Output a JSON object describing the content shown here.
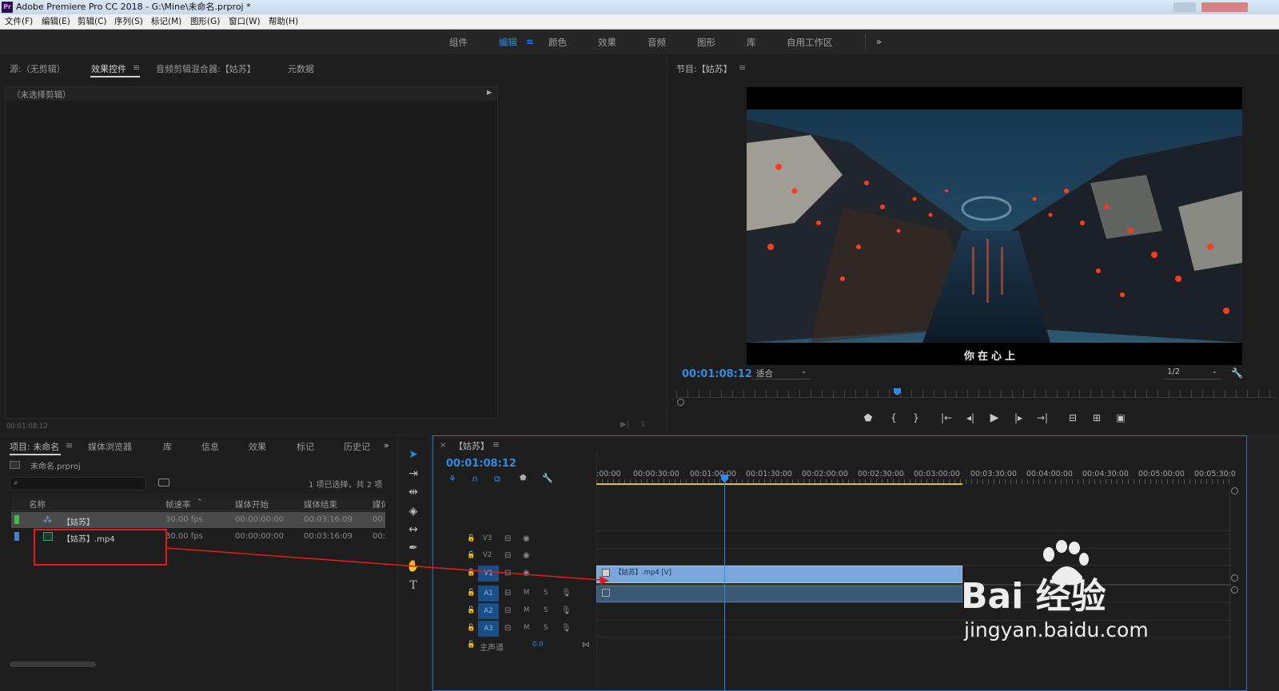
{
  "window": {
    "title": "Adobe Premiere Pro CC 2018 - G:\\Mine\\未命名.prproj *",
    "app_badge": "Pr"
  },
  "menu": [
    "文件(F)",
    "编辑(E)",
    "剪辑(C)",
    "序列(S)",
    "标记(M)",
    "图形(G)",
    "窗口(W)",
    "帮助(H)"
  ],
  "workspaces": {
    "items": [
      "组件",
      "编辑",
      "颜色",
      "效果",
      "音频",
      "图形",
      "库",
      "自用工作区"
    ],
    "active": "编辑",
    "more": "»"
  },
  "source_panel": {
    "tabs": [
      "源:（无剪辑）",
      "效果控件",
      "音频剪辑混合器:【姑苏】",
      "元数据"
    ],
    "active_tab": "效果控件",
    "no_clip": "（未选择剪辑）",
    "timecode": "00:01:08:12"
  },
  "program_panel": {
    "title": "节目:【姑苏】",
    "subtitle": "你在心上",
    "timecode": "00:01:08:12",
    "fit": "适合",
    "resolution": "1/2"
  },
  "project_panel": {
    "tabs": [
      "项目: 未命名",
      "媒体浏览器",
      "库",
      "信息",
      "效果",
      "标记",
      "历史记"
    ],
    "file": "未命名.prproj",
    "selection_info": "1 项已选择，共 2 项",
    "columns": [
      "名称",
      "帧速率",
      "媒体开始",
      "媒体结束",
      "媒体"
    ],
    "rows": [
      {
        "name": "【姑苏】",
        "fps": "30.00 fps",
        "start": "00:00:00:00",
        "end": "00:03:16:09",
        "extra": "00:",
        "color": "#3fbf4c",
        "selected": true
      },
      {
        "name": "【姑苏】.mp4",
        "fps": "30.00 fps",
        "start": "00:00:00:00",
        "end": "00:03:16:09",
        "extra": "00:",
        "color": "#4a7fd0",
        "selected": false
      }
    ]
  },
  "timeline": {
    "title": "【姑苏】",
    "timecode": "00:01:08:12",
    "ruler": [
      ":00:00",
      "00:00:30:00",
      "00:01:00:00",
      "00:01:30:00",
      "00:02:00:00",
      "00:02:30:00",
      "00:03:00:00",
      "00:03:30:00",
      "00:04:00:00",
      "00:04:30:00",
      "00:05:00:00",
      "00:05:30:0"
    ],
    "video_tracks": [
      "V3",
      "V2",
      "V1"
    ],
    "audio_tracks": [
      "A1",
      "A2",
      "A3"
    ],
    "master": {
      "label": "主声道",
      "value": "0.0"
    },
    "clip_label": "【姑苏】.mp4 [V]",
    "track_buttons": {
      "mute": "M",
      "solo": "S"
    }
  },
  "watermark": {
    "brand": "Bai  经验",
    "url": "jingyan.baidu.com"
  },
  "colors": {
    "accent": "#2d8ceb",
    "clip": "#7aa6dc",
    "annotation": "#e01c1c"
  }
}
